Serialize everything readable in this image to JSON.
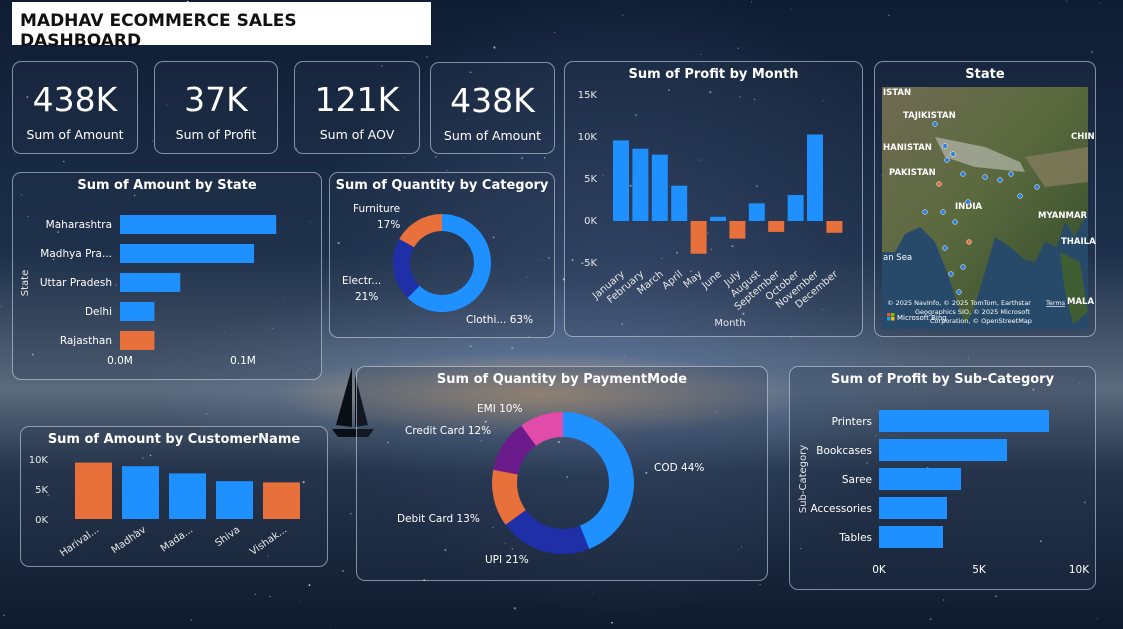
{
  "dashboard_title": "MADHAV ECOMMERCE SALES DASHBOARD",
  "kpis": [
    {
      "value": "438K",
      "label": "Sum of Amount"
    },
    {
      "value": "37K",
      "label": "Sum of Profit"
    },
    {
      "value": "121K",
      "label": "Sum of AOV"
    },
    {
      "value": "438K",
      "label": "Sum of Amount"
    }
  ],
  "colors": {
    "blue": "#1E90FF",
    "orange": "#E8703A",
    "navy": "#1F2FA8",
    "purple": "#6B1B8C",
    "pink": "#E24BAA"
  },
  "map": {
    "title": "State",
    "labels": [
      "ISTAN",
      "TAJIKISTAN",
      "CHIN",
      "HANISTAN",
      "PAKISTAN",
      "INDIA",
      "MYANMAR",
      "THAILA",
      "an Sea",
      "MALA"
    ],
    "attribution": [
      "© 2025 NavInfo, © 2025 TomTom, Earthstar",
      "Geographics SIO, © 2025 Microsoft",
      "Corporation, © OpenStreetMap"
    ],
    "terms": "Terms",
    "brand": "Microsoft Bing"
  },
  "chart_data": [
    {
      "id": "amount_by_state",
      "type": "bar",
      "orientation": "horizontal",
      "title": "Sum of Amount by State",
      "ylabel": "State",
      "categories": [
        "Maharashtra",
        "Madhya Pra...",
        "Uttar Pradesh",
        "Delhi",
        "Rajasthan"
      ],
      "values": [
        0.127,
        0.109,
        0.049,
        0.028,
        0.028
      ],
      "bar_colors": [
        "#1E90FF",
        "#1E90FF",
        "#1E90FF",
        "#1E90FF",
        "#E8703A"
      ],
      "xticks": [
        "0.0M",
        "0.1M"
      ],
      "xlim": [
        0,
        0.1
      ]
    },
    {
      "id": "quantity_by_category",
      "type": "pie",
      "donut": true,
      "title": "Sum of Quantity by Category",
      "labels": [
        "Clothi...",
        "Electr...",
        "Furniture"
      ],
      "values": [
        63,
        21,
        17
      ],
      "pct_labels": [
        "63%",
        "21%",
        "17%"
      ],
      "colors": [
        "#1E90FF",
        "#1F2FA8",
        "#E8703A"
      ]
    },
    {
      "id": "profit_by_month",
      "type": "bar",
      "title": "Sum of Profit by Month",
      "xlabel": "Month",
      "categories": [
        "January",
        "February",
        "March",
        "April",
        "May",
        "June",
        "July",
        "August",
        "September",
        "October",
        "November",
        "December"
      ],
      "values": [
        9600,
        8600,
        7900,
        4200,
        -3900,
        500,
        -2100,
        2100,
        -1300,
        3100,
        10300,
        -1400
      ],
      "yticks": [
        "15K",
        "10K",
        "5K",
        "0K",
        "-5K"
      ],
      "ylim": [
        -5000,
        15000
      ],
      "pos_color": "#1E90FF",
      "neg_color": "#E8703A"
    },
    {
      "id": "amount_by_customer",
      "type": "bar",
      "title": "Sum of Amount by CustomerName",
      "categories": [
        "Harival...",
        "Madhav",
        "Mada...",
        "Shiva",
        "Vishak..."
      ],
      "values": [
        9400,
        8800,
        7600,
        6300,
        6100
      ],
      "bar_colors": [
        "#E8703A",
        "#1E90FF",
        "#1E90FF",
        "#1E90FF",
        "#E8703A"
      ],
      "yticks": [
        "10K",
        "5K",
        "0K"
      ],
      "ylim": [
        0,
        10000
      ]
    },
    {
      "id": "quantity_by_paymentmode",
      "type": "pie",
      "donut": true,
      "title": "Sum of Quantity by PaymentMode",
      "labels": [
        "COD",
        "UPI",
        "Debit Card",
        "Credit Card",
        "EMI"
      ],
      "values": [
        44,
        21,
        13,
        12,
        10
      ],
      "slice_labels": [
        "COD 44%",
        "UPI 21%",
        "Debit Card 13%",
        "Credit Card 12%",
        "EMI 10%"
      ],
      "colors": [
        "#1E90FF",
        "#1F2FA8",
        "#E8703A",
        "#6B1B8C",
        "#E24BAA"
      ]
    },
    {
      "id": "profit_by_subcategory",
      "type": "bar",
      "orientation": "horizontal",
      "title": "Sum of Profit by Sub-Category",
      "ylabel": "Sub-Category",
      "categories": [
        "Printers",
        "Bookcases",
        "Saree",
        "Accessories",
        "Tables"
      ],
      "values": [
        8500,
        6400,
        4100,
        3400,
        3200
      ],
      "bar_colors": [
        "#1E90FF",
        "#1E90FF",
        "#1E90FF",
        "#1E90FF",
        "#1E90FF"
      ],
      "xticks": [
        "0K",
        "5K",
        "10K"
      ],
      "xlim": [
        0,
        10000
      ]
    }
  ]
}
